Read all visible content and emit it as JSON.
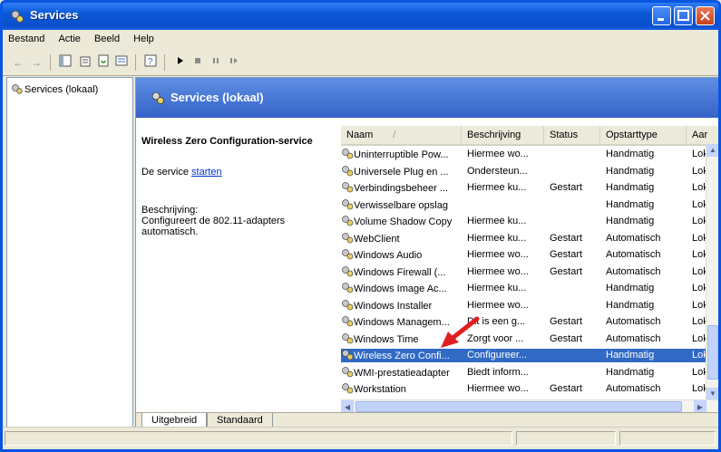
{
  "window": {
    "title": "Services"
  },
  "menu": [
    "Bestand",
    "Actie",
    "Beeld",
    "Help"
  ],
  "toolbar_icons": [
    "back-icon",
    "forward-icon",
    "show-hide-tree-icon",
    "properties-icon",
    "refresh-icon",
    "export-list-icon",
    "help-icon",
    "play-icon",
    "stop-icon",
    "pause-icon",
    "restart-icon"
  ],
  "tree": {
    "root": "Services (lokaal)"
  },
  "main": {
    "header": "Services (lokaal)",
    "service_title": "Wireless Zero Configuration-service",
    "start_prefix": "De service ",
    "start_link": "starten",
    "desc_label": "Beschrijving:",
    "desc_line1": "Configureert de 802.11-adapters",
    "desc_line2": "automatisch."
  },
  "columns": [
    "Naam",
    "Beschrijving",
    "Status",
    "Opstarttype",
    "Aar"
  ],
  "rows": [
    {
      "name": "Uninterruptible Pow...",
      "desc": "Hiermee wo...",
      "status": "",
      "start": "Handmatig",
      "logon": "Lok."
    },
    {
      "name": "Universele Plug en ...",
      "desc": "Ondersteun...",
      "status": "",
      "start": "Handmatig",
      "logon": "Lok."
    },
    {
      "name": "Verbindingsbeheer ...",
      "desc": "Hiermee ku...",
      "status": "Gestart",
      "start": "Handmatig",
      "logon": "Lok."
    },
    {
      "name": "Verwisselbare opslag",
      "desc": "",
      "status": "",
      "start": "Handmatig",
      "logon": "Lok."
    },
    {
      "name": "Volume Shadow Copy",
      "desc": "Hiermee ku...",
      "status": "",
      "start": "Handmatig",
      "logon": "Lok."
    },
    {
      "name": "WebClient",
      "desc": "Hiermee ku...",
      "status": "Gestart",
      "start": "Automatisch",
      "logon": "Lok."
    },
    {
      "name": "Windows Audio",
      "desc": "Hiermee wo...",
      "status": "Gestart",
      "start": "Automatisch",
      "logon": "Lok."
    },
    {
      "name": "Windows Firewall (...",
      "desc": "Hiermee wo...",
      "status": "Gestart",
      "start": "Automatisch",
      "logon": "Lok."
    },
    {
      "name": "Windows Image Ac...",
      "desc": "Hiermee ku...",
      "status": "",
      "start": "Handmatig",
      "logon": "Lok."
    },
    {
      "name": "Windows Installer",
      "desc": "Hiermee wo...",
      "status": "",
      "start": "Handmatig",
      "logon": "Lok."
    },
    {
      "name": "Windows Managem...",
      "desc": "Dit is een g...",
      "status": "Gestart",
      "start": "Automatisch",
      "logon": "Lok."
    },
    {
      "name": "Windows Time",
      "desc": "Zorgt voor ...",
      "status": "Gestart",
      "start": "Automatisch",
      "logon": "Lok."
    },
    {
      "name": "Wireless Zero Confi...",
      "desc": "Configureer...",
      "status": "",
      "start": "Handmatig",
      "logon": "Lok.",
      "selected": true
    },
    {
      "name": "WMI-prestatieadapter",
      "desc": "Biedt inform...",
      "status": "",
      "start": "Handmatig",
      "logon": "Lok."
    },
    {
      "name": "Workstation",
      "desc": "Hiermee wo...",
      "status": "Gestart",
      "start": "Automatisch",
      "logon": "Lok."
    }
  ],
  "tabs": [
    "Uitgebreid",
    "Standaard"
  ],
  "colors": {
    "titlebar": "#0b58d8",
    "selection": "#316ac5",
    "header_band": "#4a79d8",
    "arrow": "#e02020"
  }
}
